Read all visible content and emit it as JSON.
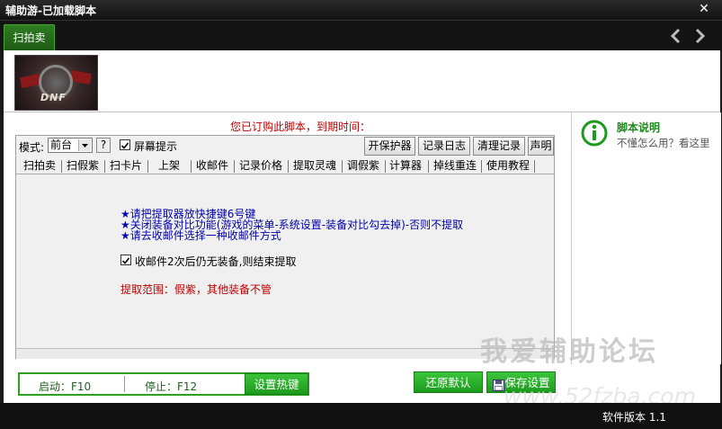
{
  "window": {
    "title": "辅助游-已加载脚本",
    "close_label": "✕"
  },
  "tabbar": {
    "active_tab": "扫拍卖"
  },
  "notice": "您已订购此脚本，到期时间：",
  "help": {
    "title": "脚本说明",
    "subtitle": "不懂怎么用？看这里"
  },
  "toolbar": {
    "mode_label": "模式:",
    "mode_value": "前台",
    "help_q": "?",
    "screen_tip_label": "屏幕提示",
    "screen_tip_checked": true,
    "buttons": [
      "开保护器",
      "记录日志",
      "清理记录",
      "声明"
    ]
  },
  "inner_tabs": [
    "扫拍卖",
    "扫假紫",
    "扫卡片",
    "上架",
    "收邮件",
    "记录价格",
    "提取灵魂",
    "调假紫",
    "计算器",
    "掉线重连",
    "使用教程"
  ],
  "content": {
    "instructions": [
      "★请把提取器放快捷键6号键",
      "★关闭装备对比功能(游戏的菜单-系统设置-装备对比勾去掉)-否则不提取",
      "★请去收邮件选择一种收邮件方式"
    ],
    "option_label": "收邮件2次后仍无装备,则结束提取",
    "option_checked": true,
    "range_text": "提取范围：假紫，其他装备不管"
  },
  "hotkeys": {
    "start": "启动：F10",
    "stop": "停止：F12",
    "set_button": "设置热键"
  },
  "actions": {
    "restore": "还原默认",
    "save": "保存设置"
  },
  "watermark": {
    "line1": "我爱辅助论坛",
    "line2": "www.52fzba.com"
  },
  "status": {
    "version": "软件版本 1.1"
  },
  "banner": {
    "logo_text": "DNF"
  }
}
